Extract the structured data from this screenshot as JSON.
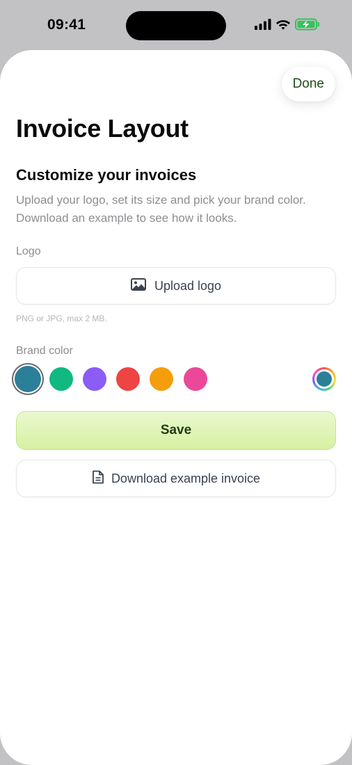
{
  "status_bar": {
    "time": "09:41",
    "icons": [
      "cellular-signal-icon",
      "wifi-icon",
      "battery-charging-icon"
    ]
  },
  "header": {
    "done_label": "Done",
    "title": "Invoice Layout"
  },
  "customize": {
    "title": "Customize your invoices",
    "description": "Upload your logo, set its size and pick your brand color. Download an example to see how it looks."
  },
  "logo": {
    "label": "Logo",
    "upload_label": "Upload logo",
    "upload_icon": "image-icon",
    "hint": "PNG or JPG, max 2 MB."
  },
  "brand_color": {
    "label": "Brand color",
    "selected_index": 0,
    "swatches": [
      {
        "name": "teal",
        "color": "#2b7f98"
      },
      {
        "name": "green",
        "color": "#10b981"
      },
      {
        "name": "purple",
        "color": "#8b5cf6"
      },
      {
        "name": "red",
        "color": "#ef4444"
      },
      {
        "name": "orange",
        "color": "#f59e0b"
      },
      {
        "name": "pink",
        "color": "#ec4899"
      }
    ],
    "custom_picker_icon": "color-wheel-icon",
    "custom_color": "#2b7f98"
  },
  "actions": {
    "save_label": "Save",
    "download_label": "Download example invoice",
    "download_icon": "document-icon"
  },
  "colors": {
    "accent_green": "#d6f0a2",
    "done_text": "#1c4d17",
    "muted_text": "#8d8d92"
  }
}
